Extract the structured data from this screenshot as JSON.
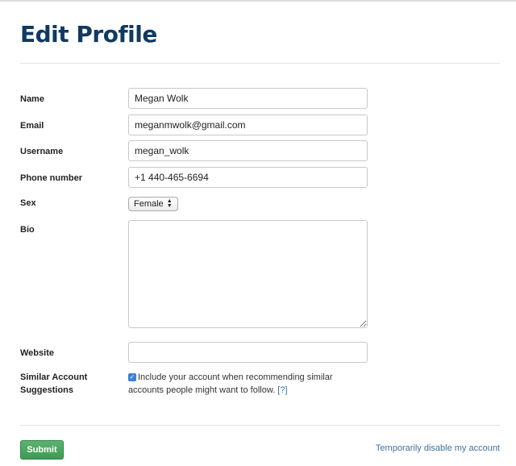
{
  "page_title": "Edit Profile",
  "fields": {
    "name": {
      "label": "Name",
      "value": "Megan Wolk"
    },
    "email": {
      "label": "Email",
      "value": "meganmwolk@gmail.com"
    },
    "username": {
      "label": "Username",
      "value": "megan_wolk"
    },
    "phone": {
      "label": "Phone number",
      "value": "+1 440-465-6694"
    },
    "sex": {
      "label": "Sex",
      "value": "Female",
      "icon": "updown-arrows-icon"
    },
    "bio": {
      "label": "Bio",
      "value": ""
    },
    "website": {
      "label": "Website",
      "value": ""
    },
    "similar": {
      "label_line1": "Similar Account",
      "label_line2": "Suggestions",
      "checked": true,
      "text": "Include your account when recommending similar accounts people might want to follow.",
      "help": "[?]"
    }
  },
  "submit_label": "Submit",
  "disable_link": "Temporarily disable my account",
  "colors": {
    "title": "#0f3a62",
    "submit": "#3c9a55",
    "link": "#3f729b"
  }
}
